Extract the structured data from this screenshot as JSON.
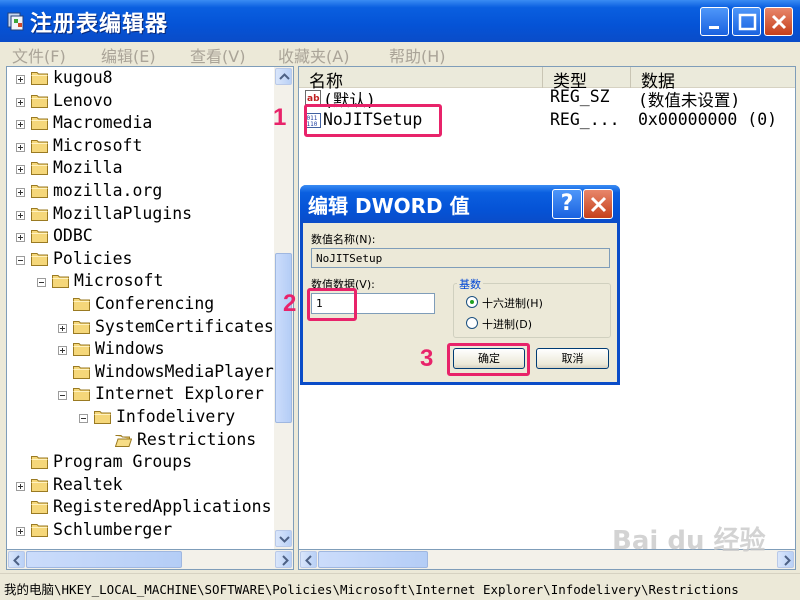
{
  "window": {
    "title": "注册表编辑器",
    "menu": [
      "文件(F)",
      "编辑(E)",
      "查看(V)",
      "收藏夹(A)",
      "帮助(H)"
    ]
  },
  "tree": {
    "items": [
      {
        "label": "kugou8",
        "level": 0,
        "expander": "plus"
      },
      {
        "label": "Lenovo",
        "level": 0,
        "expander": "plus"
      },
      {
        "label": "Macromedia",
        "level": 0,
        "expander": "plus"
      },
      {
        "label": "Microsoft",
        "level": 0,
        "expander": "plus"
      },
      {
        "label": "Mozilla",
        "level": 0,
        "expander": "plus"
      },
      {
        "label": "mozilla.org",
        "level": 0,
        "expander": "plus"
      },
      {
        "label": "MozillaPlugins",
        "level": 0,
        "expander": "plus"
      },
      {
        "label": "ODBC",
        "level": 0,
        "expander": "plus"
      },
      {
        "label": "Policies",
        "level": 0,
        "expander": "minus"
      },
      {
        "label": "Microsoft",
        "level": 1,
        "expander": "minus"
      },
      {
        "label": "Conferencing",
        "level": 2,
        "expander": "none"
      },
      {
        "label": "SystemCertificates",
        "level": 2,
        "expander": "plus"
      },
      {
        "label": "Windows",
        "level": 2,
        "expander": "plus"
      },
      {
        "label": "WindowsMediaPlayer",
        "level": 2,
        "expander": "none"
      },
      {
        "label": "Internet Explorer",
        "level": 2,
        "expander": "minus"
      },
      {
        "label": "Infodelivery",
        "level": 3,
        "expander": "minus"
      },
      {
        "label": "Restrictions",
        "level": 4,
        "expander": "none",
        "open": true
      },
      {
        "label": "Program Groups",
        "level": 0,
        "expander": "none"
      },
      {
        "label": "Realtek",
        "level": 0,
        "expander": "plus"
      },
      {
        "label": "RegisteredApplications",
        "level": 0,
        "expander": "none"
      },
      {
        "label": "Schlumberger",
        "level": 0,
        "expander": "plus"
      }
    ]
  },
  "list": {
    "columns": [
      "名称",
      "类型",
      "数据"
    ],
    "rows": [
      {
        "name": "(默认)",
        "type": "REG_SZ",
        "data": "(数值未设置)",
        "icon": "string-value-icon"
      },
      {
        "name": "NoJITSetup",
        "type": "REG_...",
        "data": "0x00000000 (0)",
        "icon": "dword-value-icon"
      }
    ]
  },
  "statusbar": {
    "path": "我的电脑\\HKEY_LOCAL_MACHINE\\SOFTWARE\\Policies\\Microsoft\\Internet Explorer\\Infodelivery\\Restrictions"
  },
  "dialog": {
    "title": "编辑 DWORD 值",
    "help_label": "?",
    "value_name_label": "数值名称(N):",
    "value_name": "NoJITSetup",
    "value_data_label": "数值数据(V):",
    "value_data": "1",
    "base_label": "基数",
    "radio_hex": "十六进制(H)",
    "radio_dec": "十进制(D)",
    "selected_base": "hex",
    "ok_label": "确定",
    "cancel_label": "取消"
  },
  "annotations": {
    "step1": "1",
    "step2": "2",
    "step3": "3",
    "color": "#e8236a"
  },
  "watermark": "Bai du 经验"
}
